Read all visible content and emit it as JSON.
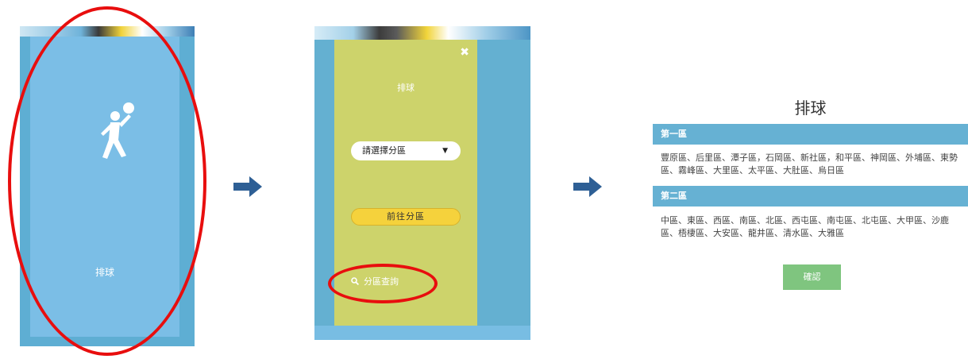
{
  "panel1": {
    "icon": "volleyball-player-icon",
    "label": "排球"
  },
  "arrows": {
    "icon": "right-arrow-icon",
    "color": "#2e5f95"
  },
  "panel2": {
    "close": "✖",
    "title": "排球",
    "select_value": "請選擇分區",
    "select_caret": "▼",
    "go_button": "前往分區",
    "query_link": "分區查詢",
    "query_icon": "search-icon"
  },
  "panel3": {
    "title": "排球",
    "zones": [
      {
        "name": "第一區",
        "districts": "豐原區、后里區、潭子區，石岡區、新社區，和平區、神岡區、外埔區、東勢區、霧峰區、大里區、太平區、大肚區、烏日區"
      },
      {
        "name": "第二區",
        "districts": "中區、東區、西區、南區、北區、西屯區、南屯區、北屯區、大甲區、沙鹿區、梧棲區、大安區、龍井區、清水區、大雅區"
      }
    ],
    "confirm": "確認"
  },
  "colors": {
    "highlight": "#e80e0e",
    "accent_blue": "#66b1d3",
    "card_olive": "#cdd36b",
    "button_yellow": "#f5d23c",
    "confirm_green": "#7fc57f"
  }
}
